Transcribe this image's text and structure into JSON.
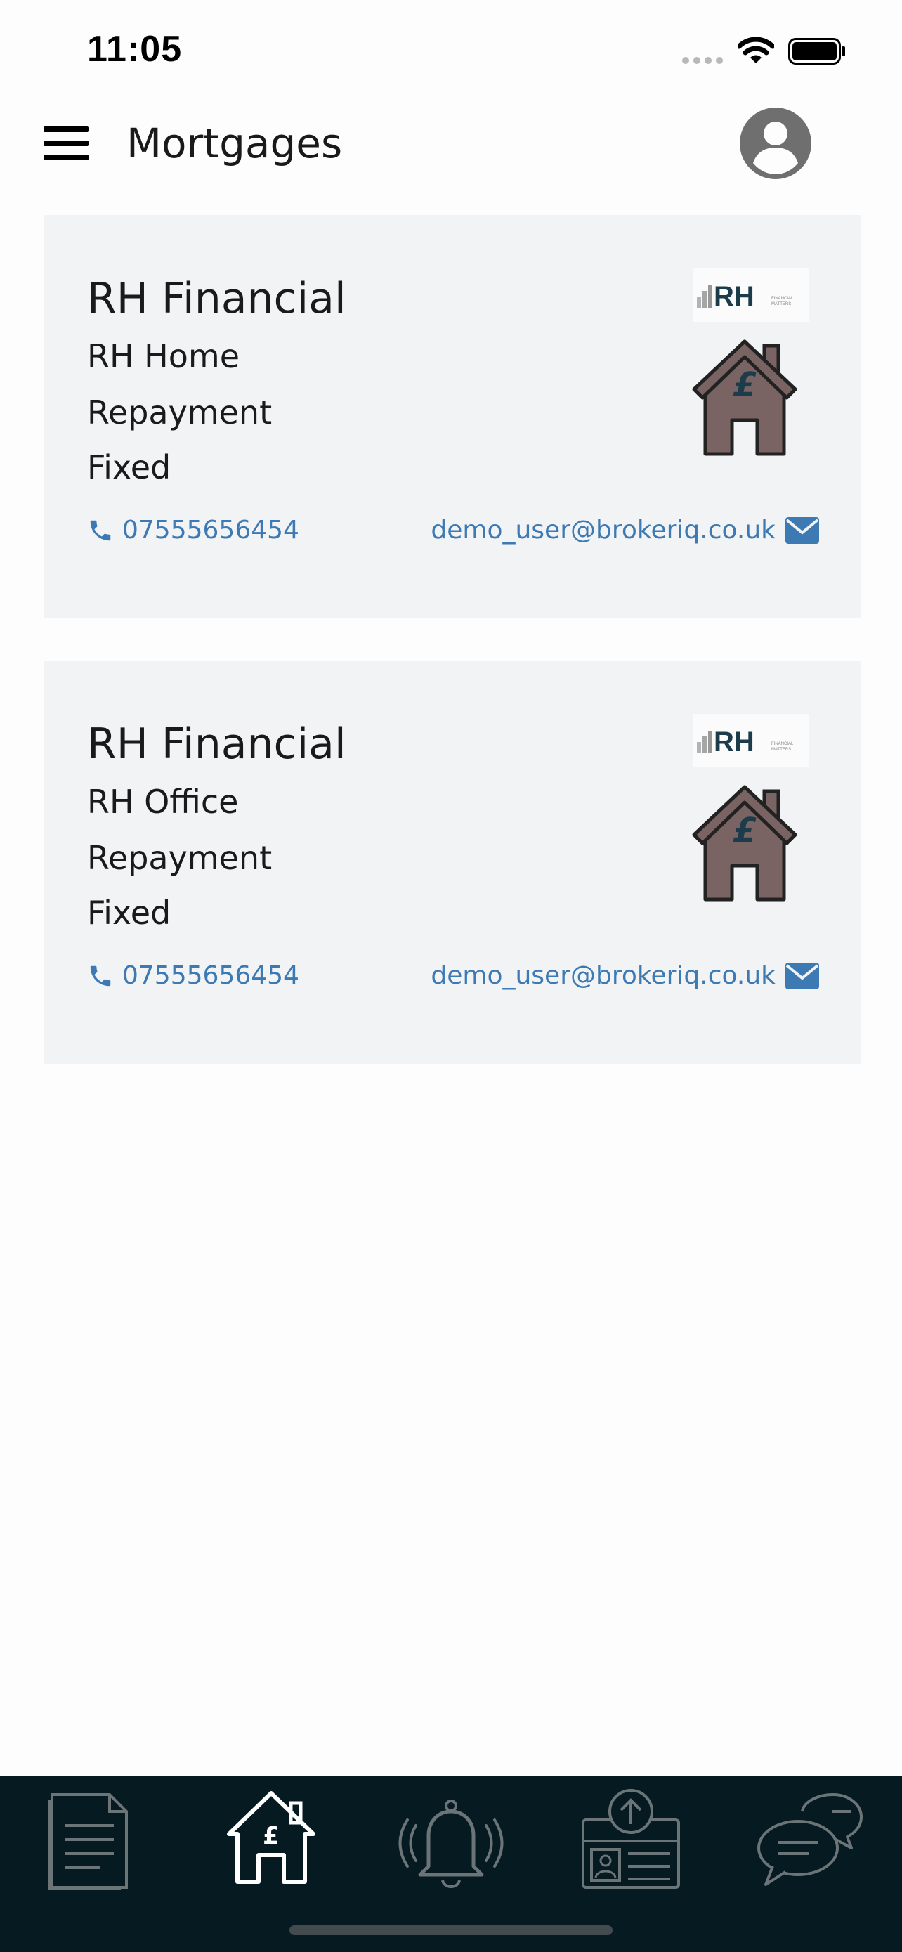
{
  "status": {
    "time": "11:05"
  },
  "header": {
    "title": "Mortgages"
  },
  "mortgages": [
    {
      "provider": "RH Financial",
      "property": "RH Home",
      "type": "Repayment",
      "rate": "Fixed",
      "phone": "07555656454",
      "email": "demo_user@brokeriq.co.uk",
      "logo_text": "RH",
      "logo_subtext": "FINANCIAL MATTERS"
    },
    {
      "provider": "RH Financial",
      "property": "RH Office",
      "type": "Repayment",
      "rate": "Fixed",
      "phone": "07555656454",
      "email": "demo_user@brokeriq.co.uk",
      "logo_text": "RH",
      "logo_subtext": "FINANCIAL MATTERS"
    }
  ],
  "tabbar": {
    "tabs": [
      {
        "icon": "document-icon",
        "active": false
      },
      {
        "icon": "house-pound-icon",
        "active": true
      },
      {
        "icon": "bell-icon",
        "active": false
      },
      {
        "icon": "id-upload-icon",
        "active": false
      },
      {
        "icon": "chat-icon",
        "active": false
      }
    ]
  },
  "colors": {
    "link": "#3d7ab4",
    "card_bg": "#f2f3f5",
    "tabbar_bg": "#061a22",
    "house_fill": "#7a6463",
    "logo_dark": "#1c3c4c"
  }
}
